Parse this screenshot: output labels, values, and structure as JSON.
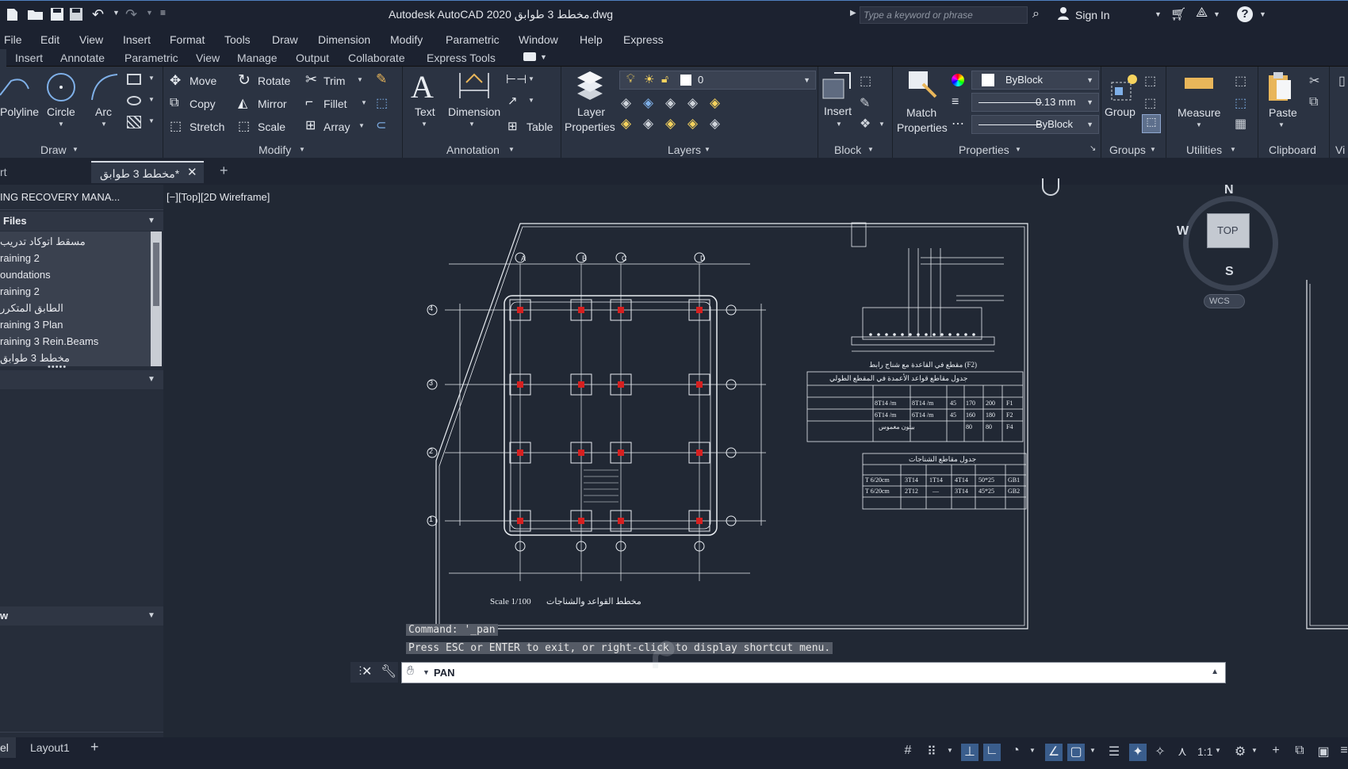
{
  "titlebar": {
    "title": "Autodesk AutoCAD 2020   مخطط 3 طوابق.dwg",
    "search_placeholder": "Type a keyword or phrase",
    "signin": "Sign In"
  },
  "menu": [
    "File",
    "Edit",
    "View",
    "Insert",
    "Format",
    "Tools",
    "Draw",
    "Dimension",
    "Modify",
    "Parametric",
    "Window",
    "Help",
    "Express"
  ],
  "ribbon_tabs": [
    "Insert",
    "Annotate",
    "Parametric",
    "View",
    "Manage",
    "Output",
    "Collaborate",
    "Express Tools"
  ],
  "ribbon": {
    "draw": {
      "polyline": "Polyline",
      "circle": "Circle",
      "arc": "Arc",
      "title": "Draw"
    },
    "modify": {
      "move": "Move",
      "rotate": "Rotate",
      "trim": "Trim",
      "copy": "Copy",
      "mirror": "Mirror",
      "fillet": "Fillet",
      "stretch": "Stretch",
      "scale": "Scale",
      "array": "Array",
      "title": "Modify"
    },
    "annotation": {
      "text": "Text",
      "dimension": "Dimension",
      "table": "Table",
      "title": "Annotation"
    },
    "layers": {
      "layer_properties_1": "Layer",
      "layer_properties_2": "Properties",
      "current_layer": "0",
      "title": "Layers"
    },
    "block": {
      "insert": "Insert",
      "title": "Block"
    },
    "properties": {
      "match_1": "Match",
      "match_2": "Properties",
      "color": "ByBlock",
      "lineweight": "0.13 mm",
      "linetype": "ByBlock",
      "title": "Properties"
    },
    "groups": {
      "group": "Group",
      "title": "Groups"
    },
    "utilities": {
      "measure": "Measure",
      "title": "Utilities"
    },
    "clipboard": {
      "paste": "Paste",
      "title": "Clipboard"
    },
    "view_partial": "Vi"
  },
  "doctabs": {
    "start_partial": "rt",
    "active_tab": "مخطط 3 طوابق*"
  },
  "leftpanel": {
    "header": "ING RECOVERY MANA...",
    "section_files": "Files",
    "files": [
      "مسقط اتوكاد تدريب",
      "raining 2",
      "oundations",
      "raining 2",
      "الطابق المتكرر",
      "raining 3 Plan",
      "raining 3 Rein.Beams",
      "مخطط 3 طوابق"
    ],
    "section_preview": "w"
  },
  "viewport": {
    "label": "[−][Top][2D Wireframe]",
    "viewcube": {
      "n": "N",
      "w": "W",
      "s": "S",
      "top": "TOP",
      "wcs": "WCS"
    }
  },
  "drawing": {
    "plan_title": "مخطط القواعد والشناجات",
    "plan_scale": "Scale 1/100",
    "section_title": "مقطع في القاعدة مع شناج رابط (F2)",
    "table1_title": "جدول مقاطع قواعد الأعمدة في المقطع الطولي",
    "table1_rows": [
      [
        "8T14 /m",
        "8T14 /m",
        "45",
        "170",
        "200",
        "F1"
      ],
      [
        "6T14 /m",
        "6T14 /m",
        "45",
        "160",
        "180",
        "F2"
      ],
      [
        "بيتون مغموس",
        "",
        "",
        "80",
        "80",
        "F4"
      ]
    ],
    "table2_title": "جدول مقاطع الشناجات",
    "table2_rows": [
      [
        "T 6/20cm",
        "3T14",
        "1T14",
        "4T14",
        "50*25",
        "GB1"
      ],
      [
        "T 6/20cm",
        "2T12",
        "—",
        "3T14",
        "45*25",
        "GB2"
      ]
    ],
    "axis_letters": [
      "A",
      "B",
      "C",
      "D"
    ],
    "axis_numbers": [
      "4",
      "3",
      "2",
      "1"
    ]
  },
  "command": {
    "line1": "Command: '_pan",
    "line2": "Press ESC or ENTER to exit, or right-click to display shortcut menu.",
    "prompt": "PAN"
  },
  "layouts": {
    "model_partial": "el",
    "layout1": "Layout1"
  },
  "status": {
    "scale": "1:1"
  }
}
